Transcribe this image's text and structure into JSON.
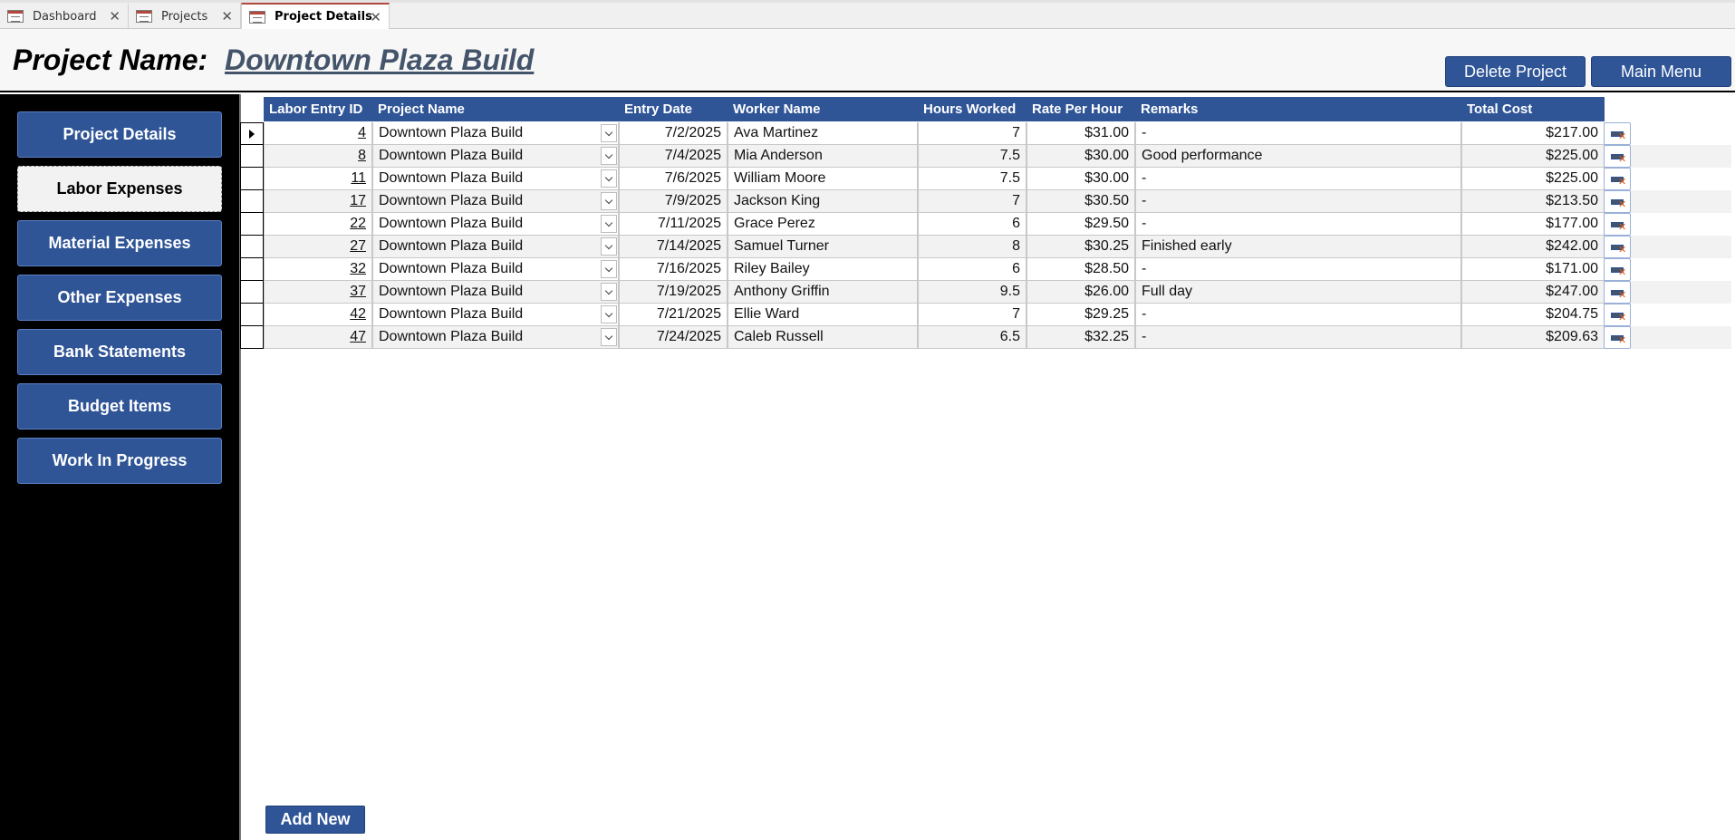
{
  "tabs": [
    {
      "label": "Dashboard",
      "active": false
    },
    {
      "label": "Projects",
      "active": false
    },
    {
      "label": "Project Details",
      "active": true
    }
  ],
  "header": {
    "title_label": "Project Name:",
    "project_name": "Downtown Plaza Build",
    "delete_label": "Delete Project",
    "main_menu_label": "Main Menu"
  },
  "sidebar": {
    "items": [
      {
        "label": "Project Details",
        "active": false
      },
      {
        "label": "Labor Expenses",
        "active": true
      },
      {
        "label": "Material Expenses",
        "active": false
      },
      {
        "label": "Other Expenses",
        "active": false
      },
      {
        "label": "Bank Statements",
        "active": false
      },
      {
        "label": "Budget Items",
        "active": false
      },
      {
        "label": "Work In Progress",
        "active": false
      }
    ]
  },
  "table": {
    "columns": [
      "Labor Entry ID",
      "Project Name",
      "Entry Date",
      "Worker Name",
      "Hours Worked",
      "Rate Per Hour",
      "Remarks",
      "Total Cost"
    ],
    "rows": [
      [
        "4",
        "Downtown Plaza Build",
        "7/2/2025",
        "Ava Martinez",
        "7",
        "$31.00",
        "-",
        "$217.00"
      ],
      [
        "8",
        "Downtown Plaza Build",
        "7/4/2025",
        "Mia Anderson",
        "7.5",
        "$30.00",
        "Good performance",
        "$225.00"
      ],
      [
        "11",
        "Downtown Plaza Build",
        "7/6/2025",
        "William Moore",
        "7.5",
        "$30.00",
        "-",
        "$225.00"
      ],
      [
        "17",
        "Downtown Plaza Build",
        "7/9/2025",
        "Jackson King",
        "7",
        "$30.50",
        "-",
        "$213.50"
      ],
      [
        "22",
        "Downtown Plaza Build",
        "7/11/2025",
        "Grace Perez",
        "6",
        "$29.50",
        "-",
        "$177.00"
      ],
      [
        "27",
        "Downtown Plaza Build",
        "7/14/2025",
        "Samuel Turner",
        "8",
        "$30.25",
        "Finished early",
        "$242.00"
      ],
      [
        "32",
        "Downtown Plaza Build",
        "7/16/2025",
        "Riley Bailey",
        "6",
        "$28.50",
        "-",
        "$171.00"
      ],
      [
        "37",
        "Downtown Plaza Build",
        "7/19/2025",
        "Anthony Griffin",
        "9.5",
        "$26.00",
        "Full day",
        "$247.00"
      ],
      [
        "42",
        "Downtown Plaza Build",
        "7/21/2025",
        "Ellie Ward",
        "7",
        "$29.25",
        "-",
        "$204.75"
      ],
      [
        "47",
        "Downtown Plaza Build",
        "7/24/2025",
        "Caleb Russell",
        "6.5",
        "$32.25",
        "-",
        "$209.63"
      ]
    ],
    "current_row": 0
  },
  "footer": {
    "add_label": "Add New"
  },
  "colors": {
    "accent": "#2f5597",
    "tab_accent": "#b04a3f",
    "project_name": "#44546a"
  }
}
